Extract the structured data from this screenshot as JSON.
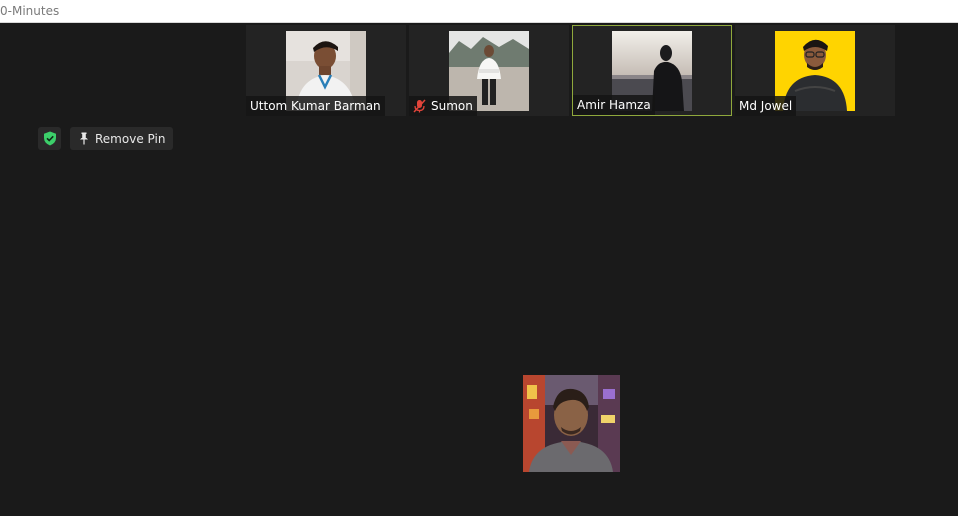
{
  "window": {
    "title": "0-Minutes"
  },
  "participants": [
    {
      "name": "Uttom Kumar Barman",
      "muted": false,
      "active": false
    },
    {
      "name": "Sumon",
      "muted": true,
      "active": false
    },
    {
      "name": "Amir Hamza",
      "muted": false,
      "active": true
    },
    {
      "name": "Md Jowel",
      "muted": false,
      "active": false
    }
  ],
  "toolbar": {
    "remove_pin_label": "Remove Pin"
  },
  "colors": {
    "background": "#1a1a1a",
    "active_border": "#8fa83c",
    "shield_green": "#3ccf6a",
    "mute_red": "#e0443a"
  }
}
